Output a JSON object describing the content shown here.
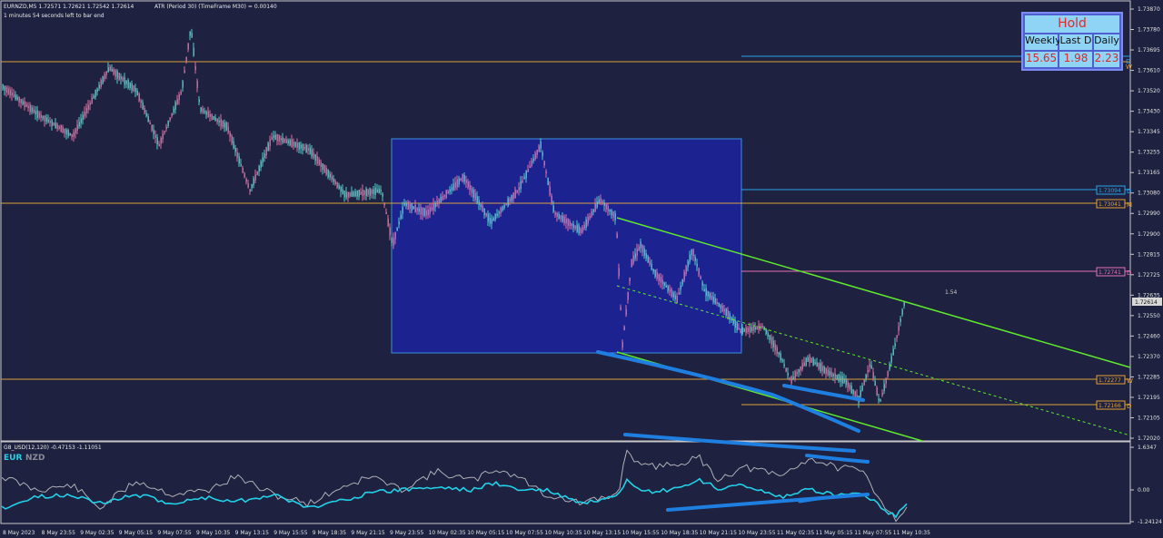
{
  "window": {
    "symbol_line": "EURNZD,M5  1.72571 1.72621 1.72542 1.72614",
    "timer_line": "1 minutes 54 seconds left to bar end",
    "indicator_line": "ATR (Period 30) (TimeFrame M30) = 0.00140"
  },
  "sub_window": {
    "title": "G8_USD(12,120) -0.47153 -1.11051",
    "legend_eur": "EUR",
    "legend_nzd": "NZD",
    "ticks": [
      "1.6347",
      "0.00",
      "-1.24124"
    ]
  },
  "price_axis": {
    "ticks": [
      "1.73870",
      "1.73780",
      "1.73695",
      "1.73610",
      "1.73520",
      "1.73430",
      "1.73345",
      "1.73255",
      "1.73165",
      "1.73080",
      "1.72990",
      "1.72900",
      "1.72815",
      "1.72725",
      "1.72635",
      "1.72550",
      "1.72460",
      "1.72370",
      "1.72285",
      "1.72195",
      "1.72105",
      "1.72020"
    ],
    "current_price": "1.72614"
  },
  "level_labels": [
    {
      "text": "1.73094",
      "tag": "D",
      "color": "#2aa3e6"
    },
    {
      "text": "1.73041",
      "tag": "M",
      "color": "#e6a030"
    },
    {
      "text": "1.72741",
      "tag": "D",
      "color": "#e673b6"
    },
    {
      "text": "1.72277",
      "tag": "W",
      "color": "#e6a030"
    },
    {
      "text": "1.72166",
      "tag": "D",
      "color": "#e6a030"
    }
  ],
  "right_tags": {
    "top_d": "D",
    "top_w": "W"
  },
  "annotation": "1.54",
  "time_axis": [
    "8 May 2023",
    "8 May 23:55",
    "9 May 02:35",
    "9 May 05:15",
    "9 May 07:55",
    "9 May 10:35",
    "9 May 13:15",
    "9 May 15:55",
    "9 May 18:35",
    "9 May 21:15",
    "9 May 23:55",
    "10 May 02:35",
    "10 May 05:15",
    "10 May 07:55",
    "10 May 10:35",
    "10 May 13:15",
    "10 May 15:55",
    "10 May 18:35",
    "10 May 21:15",
    "10 May 23:55",
    "11 May 02:35",
    "11 May 05:15",
    "11 May 07:55",
    "11 May 10:35"
  ],
  "strength_panel": {
    "title": "Hold",
    "headers": [
      "Weekly",
      "Last D",
      "Daily"
    ],
    "values": [
      "15.65",
      "1.98",
      "2.23"
    ]
  },
  "colors": {
    "background": "#1e2240",
    "bull_candle": "#4ecfc6",
    "bear_candle": "#e06fa0",
    "channel": "#5ee82e",
    "box": "#1c2391",
    "eur_line": "#22d0e8",
    "nzd_line": "#b0b0b8",
    "trend_marks": "#1f7fe0"
  }
}
